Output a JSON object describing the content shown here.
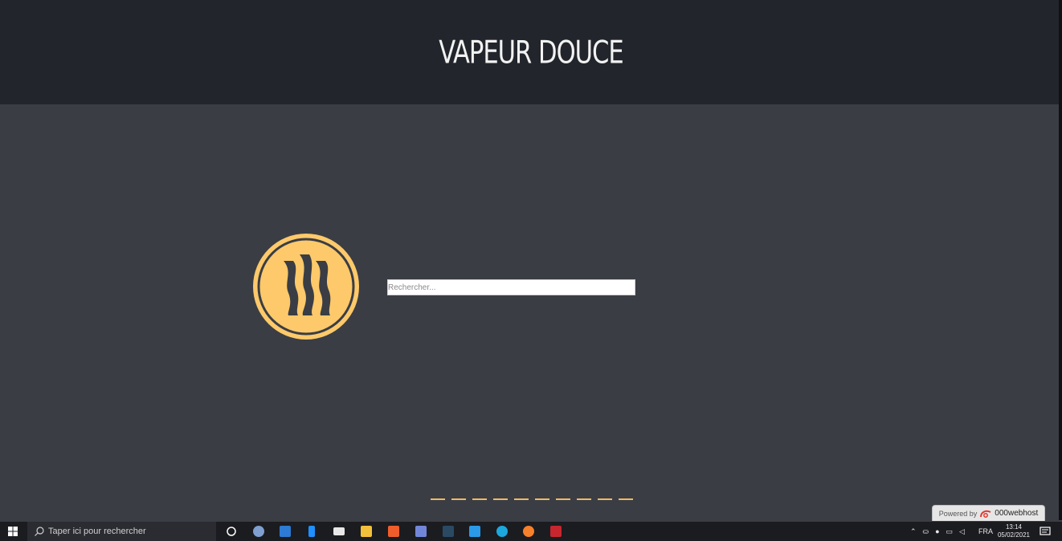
{
  "header": {
    "title": "VAPEUR DOUCE"
  },
  "search": {
    "placeholder": "Rechercher..."
  },
  "loader": {
    "dash_count": 10,
    "color": "#f3b95f"
  },
  "badge": {
    "prefix": "Powered by",
    "brand": "000webhost"
  },
  "taskbar": {
    "search_placeholder": "Taper ici pour rechercher",
    "apps": [
      "cortana-icon",
      "paint-icon",
      "mail-icon",
      "notes-icon",
      "monitor-icon",
      "file-explorer-icon",
      "brave-icon",
      "discord-icon",
      "app-icon",
      "vscode-icon",
      "edge-icon",
      "firefox-icon",
      "filezilla-icon"
    ],
    "language": "FRA",
    "time": "13:14",
    "date": "05/02/2021"
  },
  "colors": {
    "background": "#3a3d44",
    "header": "#22262c",
    "logo": "#fdc96a"
  }
}
